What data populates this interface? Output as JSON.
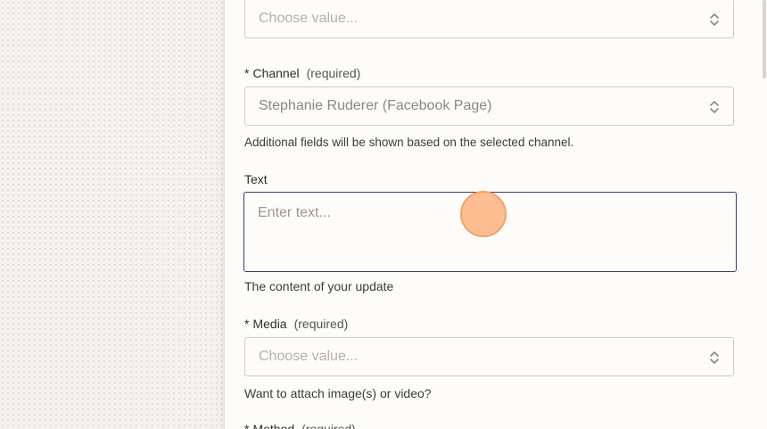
{
  "fields": {
    "top_select": {
      "placeholder": "Choose value..."
    },
    "channel": {
      "label": "Channel",
      "required_marker": "*",
      "required_text": "(required)",
      "value": "Stephanie Ruderer (Facebook Page)",
      "help": "Additional fields will be shown based on the selected channel."
    },
    "text": {
      "label": "Text",
      "placeholder": "Enter text...",
      "help": "The content of your update"
    },
    "media": {
      "label": "Media",
      "required_marker": "*",
      "required_text": "(required)",
      "placeholder": "Choose value...",
      "help": "Want to attach image(s) or video?"
    },
    "method": {
      "label": "Method",
      "required_marker": "*",
      "required_text": "(required)"
    }
  },
  "icons": {
    "select_chevron": "chevron-up-down-icon",
    "cursor": "click-indicator"
  },
  "colors": {
    "focus_border": "#3d3a70",
    "click_indicator": "#ffb280"
  }
}
